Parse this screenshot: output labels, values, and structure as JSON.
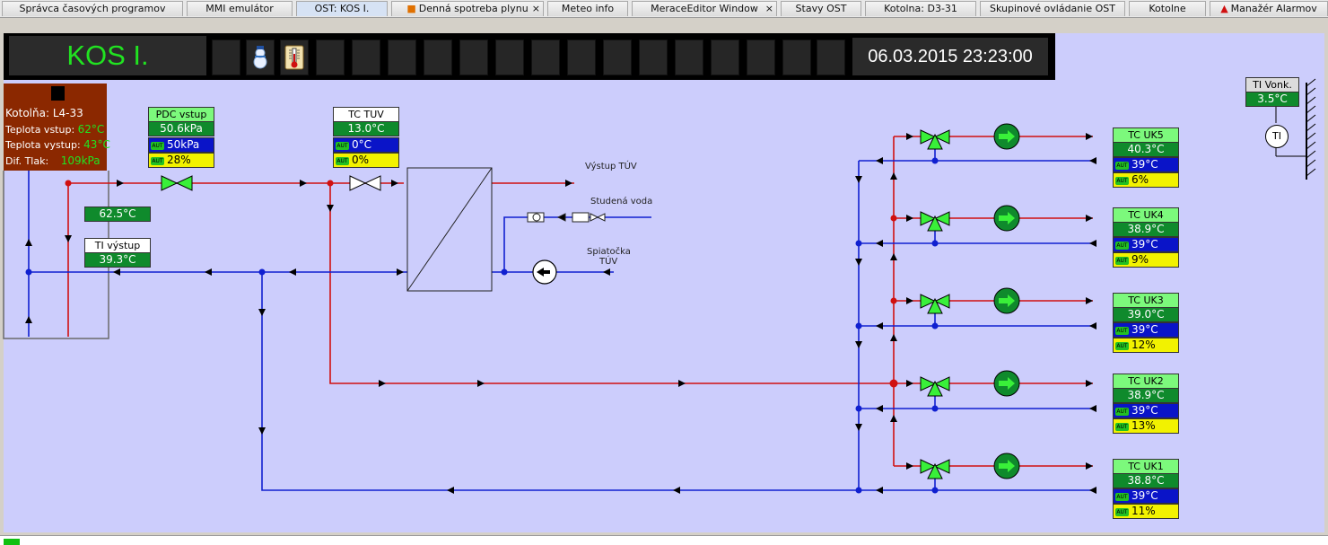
{
  "tabs": [
    {
      "label": "Správca časových programov",
      "active": false
    },
    {
      "label": "MMI emulátor",
      "active": false
    },
    {
      "label": "OST: KOS I.",
      "active": true
    },
    {
      "label": "Denná spotreba plynu",
      "active": false,
      "closable": true
    },
    {
      "label": "Meteo info",
      "active": false
    },
    {
      "label": "MeraceEditor Window",
      "active": false,
      "closable": true
    },
    {
      "label": "Stavy OST",
      "active": false
    },
    {
      "label": "Kotolna: D3-31",
      "active": false
    },
    {
      "label": "Skupinové ovládanie OST",
      "active": false
    },
    {
      "label": "Kotolne",
      "active": false
    },
    {
      "label": "Manažér Alarmov",
      "active": false
    }
  ],
  "tab_close_glyph": "×",
  "header": {
    "title": "KOS I.",
    "datetime": "06.03.2015 23:23:00"
  },
  "boiler": {
    "name_label": "Kotolňa:",
    "name_value": "L4-33",
    "inlet_label": "Teplota vstup:",
    "inlet_value": "62°C",
    "outlet_label": "Teplota vystup:",
    "outlet_value": "43°C",
    "dp_label": "Dif. Tlak:",
    "dp_value": "109kPa"
  },
  "pdc": {
    "label": "PDC vstup",
    "value": "50.6kPa",
    "setpoint": "50kPa",
    "output": "28%"
  },
  "tc_tuv": {
    "label": "TC TUV",
    "value": "13.0°C",
    "setpoint": "0°C",
    "output": "0%"
  },
  "supply_temp": "62.5°C",
  "ti_vystup": {
    "label": "TI výstup",
    "value": "39.3°C"
  },
  "ti_vonk": {
    "label": "TI Vonk.",
    "value": "3.5°C",
    "symbol": "TI"
  },
  "aut_label": "AUT",
  "texts": {
    "vystup_tuv": "Výstup TÚV",
    "studena_voda": "Studená voda",
    "spiatocka": "Spiatočka",
    "tuv": "TÚV"
  },
  "circuits": [
    {
      "label": "TC UK5",
      "value": "40.3°C",
      "setpoint": "39°C",
      "output": "6%"
    },
    {
      "label": "TC UK4",
      "value": "38.9°C",
      "setpoint": "39°C",
      "output": "9%"
    },
    {
      "label": "TC UK3",
      "value": "39.0°C",
      "setpoint": "39°C",
      "output": "12%"
    },
    {
      "label": "TC UK2",
      "value": "38.9°C",
      "setpoint": "39°C",
      "output": "13%"
    },
    {
      "label": "TC UK1",
      "value": "38.8°C",
      "setpoint": "39°C",
      "output": "11%"
    }
  ],
  "colors": {
    "supply": "#d01010",
    "return": "#1020d0",
    "valve": "#39f039",
    "pump": "#0f8a2c",
    "canvas": "#cccdfc"
  }
}
